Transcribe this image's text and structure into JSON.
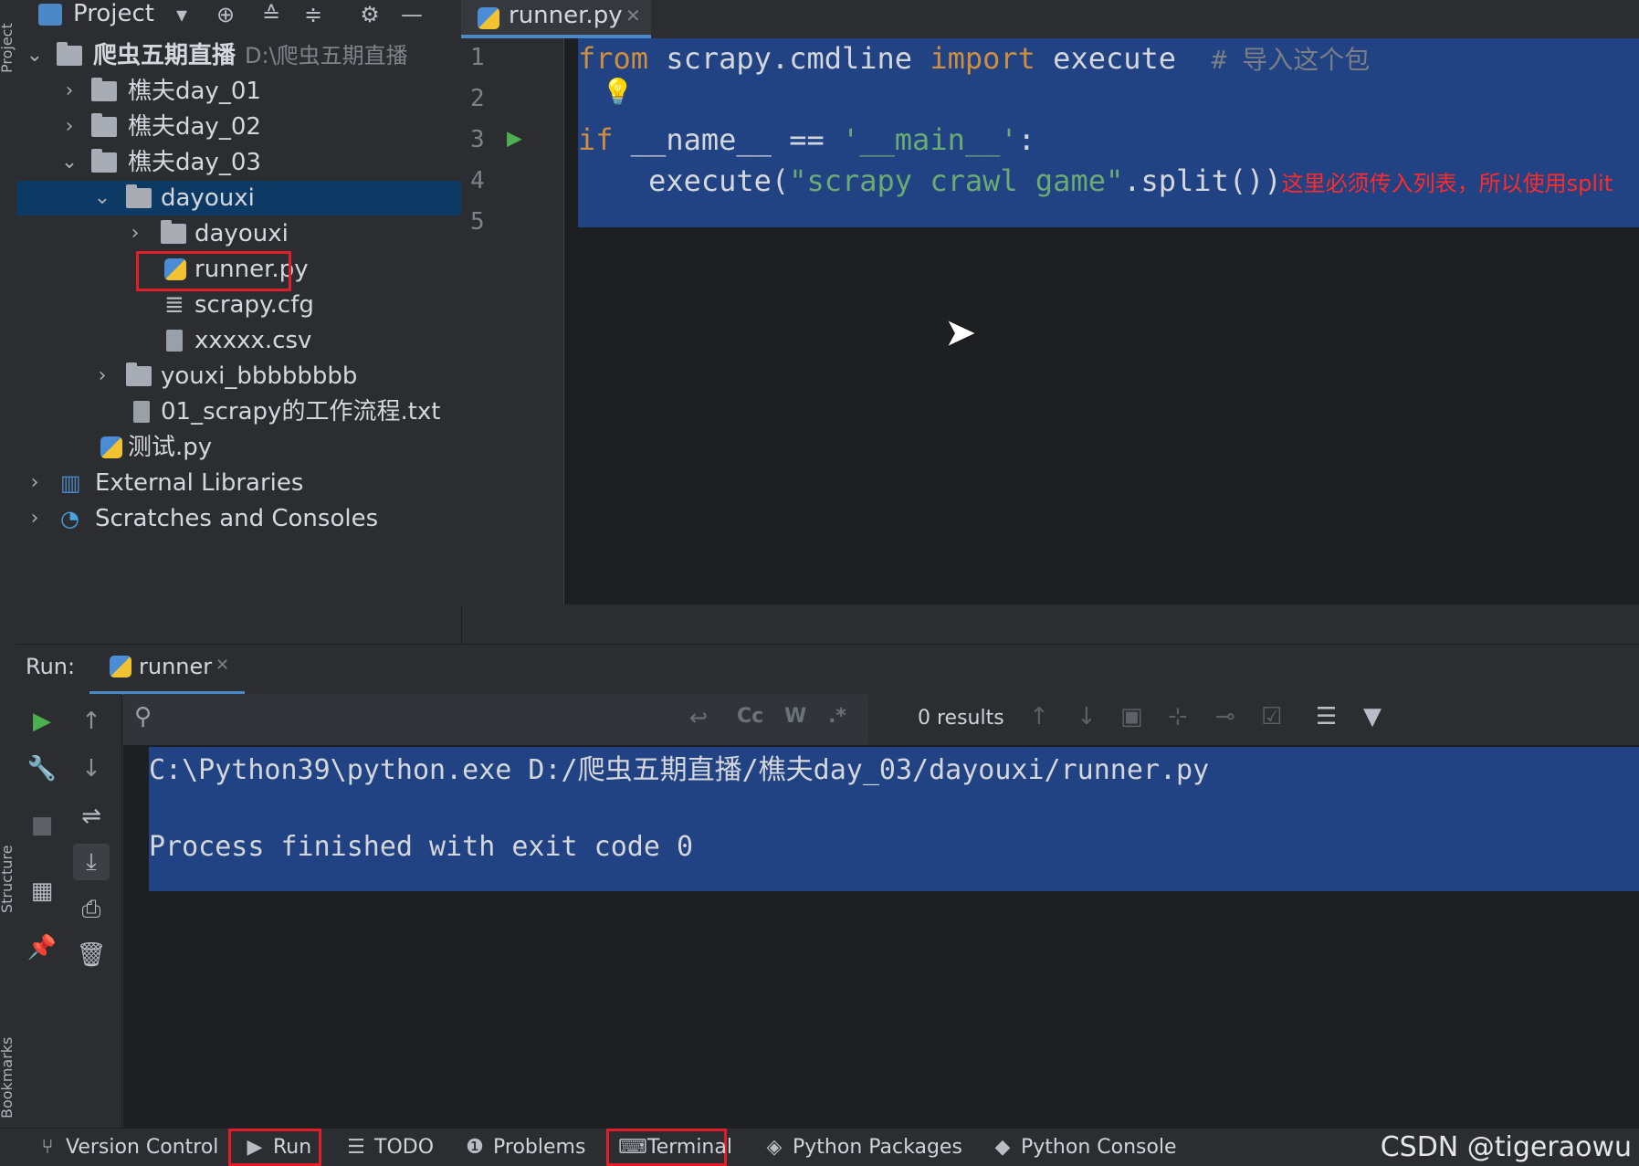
{
  "project_panel": {
    "title": "Project",
    "items": [
      {
        "label": "爬虫五期直播",
        "path": "D:\\爬虫五期直播",
        "type": "folder",
        "expanded": true
      },
      {
        "label": "樵夫day_01",
        "type": "folder",
        "expanded": false
      },
      {
        "label": "樵夫day_02",
        "type": "folder",
        "expanded": false
      },
      {
        "label": "樵夫day_03",
        "type": "folder",
        "expanded": true
      },
      {
        "label": "dayouxi",
        "type": "folder",
        "expanded": true,
        "selected": true
      },
      {
        "label": "dayouxi",
        "type": "package",
        "expanded": false
      },
      {
        "label": "runner.py",
        "type": "python-file",
        "highlighted": true
      },
      {
        "label": "scrapy.cfg",
        "type": "config-file"
      },
      {
        "label": "xxxxx.csv",
        "type": "csv-file"
      },
      {
        "label": "youxi_bbbbbbbb",
        "type": "folder",
        "expanded": false
      },
      {
        "label": "01_scrapy的工作流程.txt",
        "type": "text-file"
      },
      {
        "label": "测试.py",
        "type": "python-file"
      },
      {
        "label": "External Libraries",
        "type": "libraries",
        "expanded": false
      },
      {
        "label": "Scratches and Consoles",
        "type": "scratches",
        "expanded": false
      }
    ]
  },
  "editor": {
    "tab_label": "runner.py",
    "line_numbers": [
      "1",
      "2",
      "3",
      "4",
      "5"
    ],
    "code": {
      "l1_from": "from",
      "l1_module": " scrapy.cmdline ",
      "l1_import": "import",
      "l1_name": " execute  ",
      "l1_comment": "# 导入这个包",
      "l3_if": "if",
      "l3_mid": " __name__ == ",
      "l3_str": "'__main__'",
      "l3_end": ":",
      "l4_call": "    execute(",
      "l4_str": "\"scrapy crawl game\"",
      "l4_end": ".split())"
    },
    "annotation": "这里必须传入列表，所以使用split"
  },
  "run_panel": {
    "label": "Run:",
    "tab_label": "runner",
    "search_results": "0 results",
    "search_options": [
      "Cc",
      "W",
      ".*"
    ],
    "console_lines": [
      "C:\\Python39\\python.exe D:/爬虫五期直播/樵夫day_03/dayouxi/runner.py",
      "",
      "Process finished with exit code 0"
    ]
  },
  "side_labels": {
    "project": "Project",
    "structure": "Structure",
    "bookmarks": "Bookmarks"
  },
  "bottom_bar": {
    "version_control": "Version Control",
    "run": "Run",
    "todo": "TODO",
    "problems": "Problems",
    "terminal": "Terminal",
    "python_packages": "Python Packages",
    "python_console": "Python Console"
  },
  "watermark": "CSDN @tigeraowu",
  "colors": {
    "selection": "#214283",
    "keyword": "#cf8e3f",
    "string": "#6aab73",
    "annotation": "#ff2a2a",
    "highlight_box": "#e11d2a"
  }
}
